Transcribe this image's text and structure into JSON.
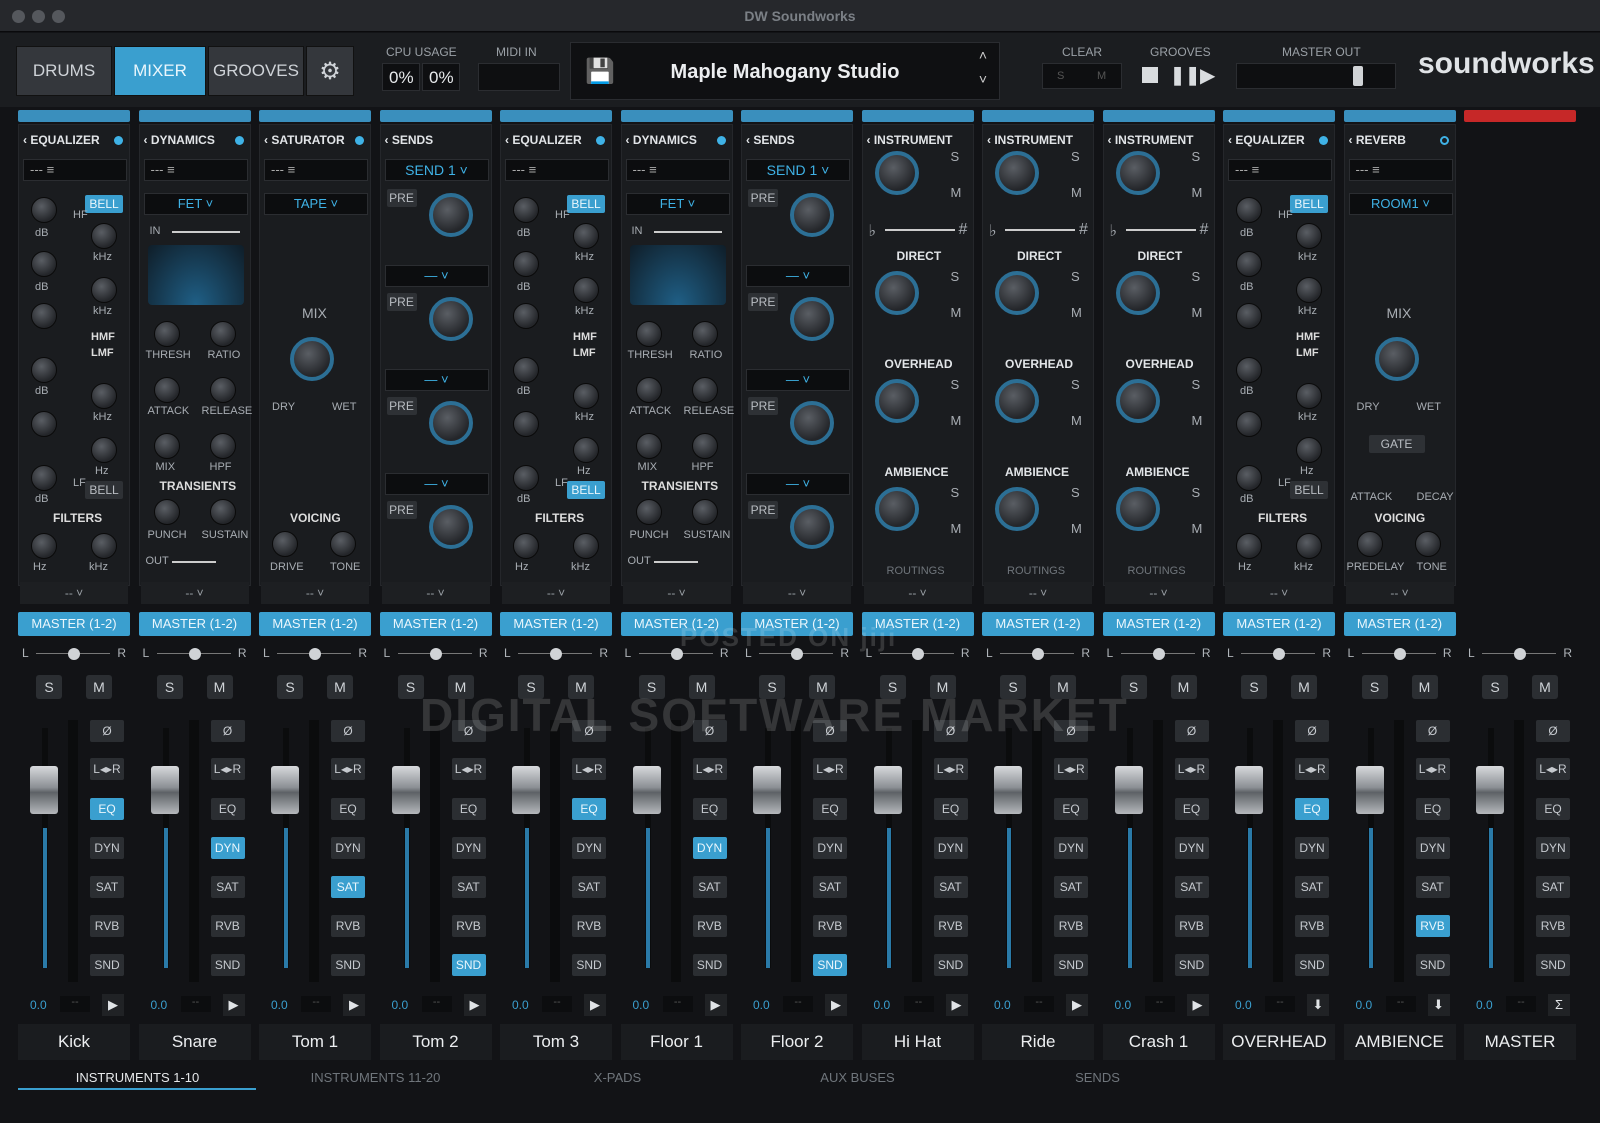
{
  "window": {
    "title": "DW Soundworks"
  },
  "nav": {
    "tabs": [
      "DRUMS",
      "MIXER",
      "GROOVES"
    ],
    "active": "MIXER"
  },
  "top": {
    "cpu_label": "CPU USAGE",
    "cpu1": "0%",
    "cpu2": "0%",
    "midi_label": "MIDI IN",
    "preset": "Maple Mahogany Studio",
    "clear_label": "CLEAR",
    "clear_s": "S",
    "clear_m": "M",
    "grooves_label": "GROOVES",
    "master_label": "MASTER OUT",
    "brand": "soundworks"
  },
  "strips": [
    {
      "name": "Kick",
      "panel": "EQUALIZER",
      "fx": "EQ"
    },
    {
      "name": "Snare",
      "panel": "DYNAMICS",
      "fx": "DYN"
    },
    {
      "name": "Tom 1",
      "panel": "SATURATOR",
      "fx": "SAT"
    },
    {
      "name": "Tom 2",
      "panel": "SENDS",
      "fx": "SND"
    },
    {
      "name": "Tom 3",
      "panel": "EQUALIZER",
      "fx": "EQ"
    },
    {
      "name": "Floor 1",
      "panel": "DYNAMICS",
      "fx": "DYN"
    },
    {
      "name": "Floor 2",
      "panel": "SENDS",
      "fx": "SND"
    },
    {
      "name": "Hi Hat",
      "panel": "INSTRUMENT",
      "fx": ""
    },
    {
      "name": "Ride",
      "panel": "INSTRUMENT",
      "fx": ""
    },
    {
      "name": "Crash 1",
      "panel": "INSTRUMENT",
      "fx": ""
    },
    {
      "name": "OVERHEAD",
      "panel": "EQUALIZER",
      "fx": "EQ"
    },
    {
      "name": "AMBIENCE",
      "panel": "REVERB",
      "fx": "RVB"
    },
    {
      "name": "MASTER",
      "panel": "",
      "fx": ""
    }
  ],
  "common": {
    "route": "MASTER (1-2)",
    "l": "L",
    "r": "R",
    "s": "S",
    "m": "M",
    "vol": "0.0",
    "dash": "--",
    "phase": "Ø",
    "swap": "L◂▸R",
    "fx": [
      "EQ",
      "DYN",
      "SAT",
      "RVB",
      "SND"
    ]
  },
  "labels": {
    "bell": "BELL",
    "hf": "HF",
    "db": "dB",
    "khz": "kHz",
    "hz": "Hz",
    "hmf": "HMF",
    "lmf": "LMF",
    "lf": "LF",
    "filters": "FILTERS",
    "fet": "FET",
    "in": "IN",
    "thresh": "THRESH",
    "ratio": "RATIO",
    "attack": "ATTACK",
    "release": "RELEASE",
    "mix": "MIX",
    "hpf": "HPF",
    "transients": "TRANSIENTS",
    "punch": "PUNCH",
    "sustain": "SUSTAIN",
    "out": "OUT",
    "tape": "TAPE",
    "dry": "DRY",
    "wet": "WET",
    "voicing": "VOICING",
    "drive": "DRIVE",
    "tone": "TONE",
    "send1": "SEND 1",
    "pre": "PRE",
    "direct": "DIRECT",
    "overhead": "OVERHEAD",
    "ambience": "AMBIENCE",
    "routings": "ROUTINGS",
    "room": "ROOM1",
    "gate": "GATE",
    "decay": "DECAY",
    "predelay": "PREDELAY",
    "flat": "♭",
    "sharp": "#"
  },
  "groups": [
    "INSTRUMENTS 1-10",
    "INSTRUMENTS 11-20",
    "X-PADS",
    "AUX BUSES",
    "SENDS"
  ],
  "watermark": {
    "line1": "POSTED ON jiji",
    "line2": "DIGITAL SOFTWARE MARKET"
  },
  "colors": {
    "accent": "#3a9fcf",
    "panel": "#1a1c1f",
    "bg": "#121316",
    "red": "#c62828"
  }
}
